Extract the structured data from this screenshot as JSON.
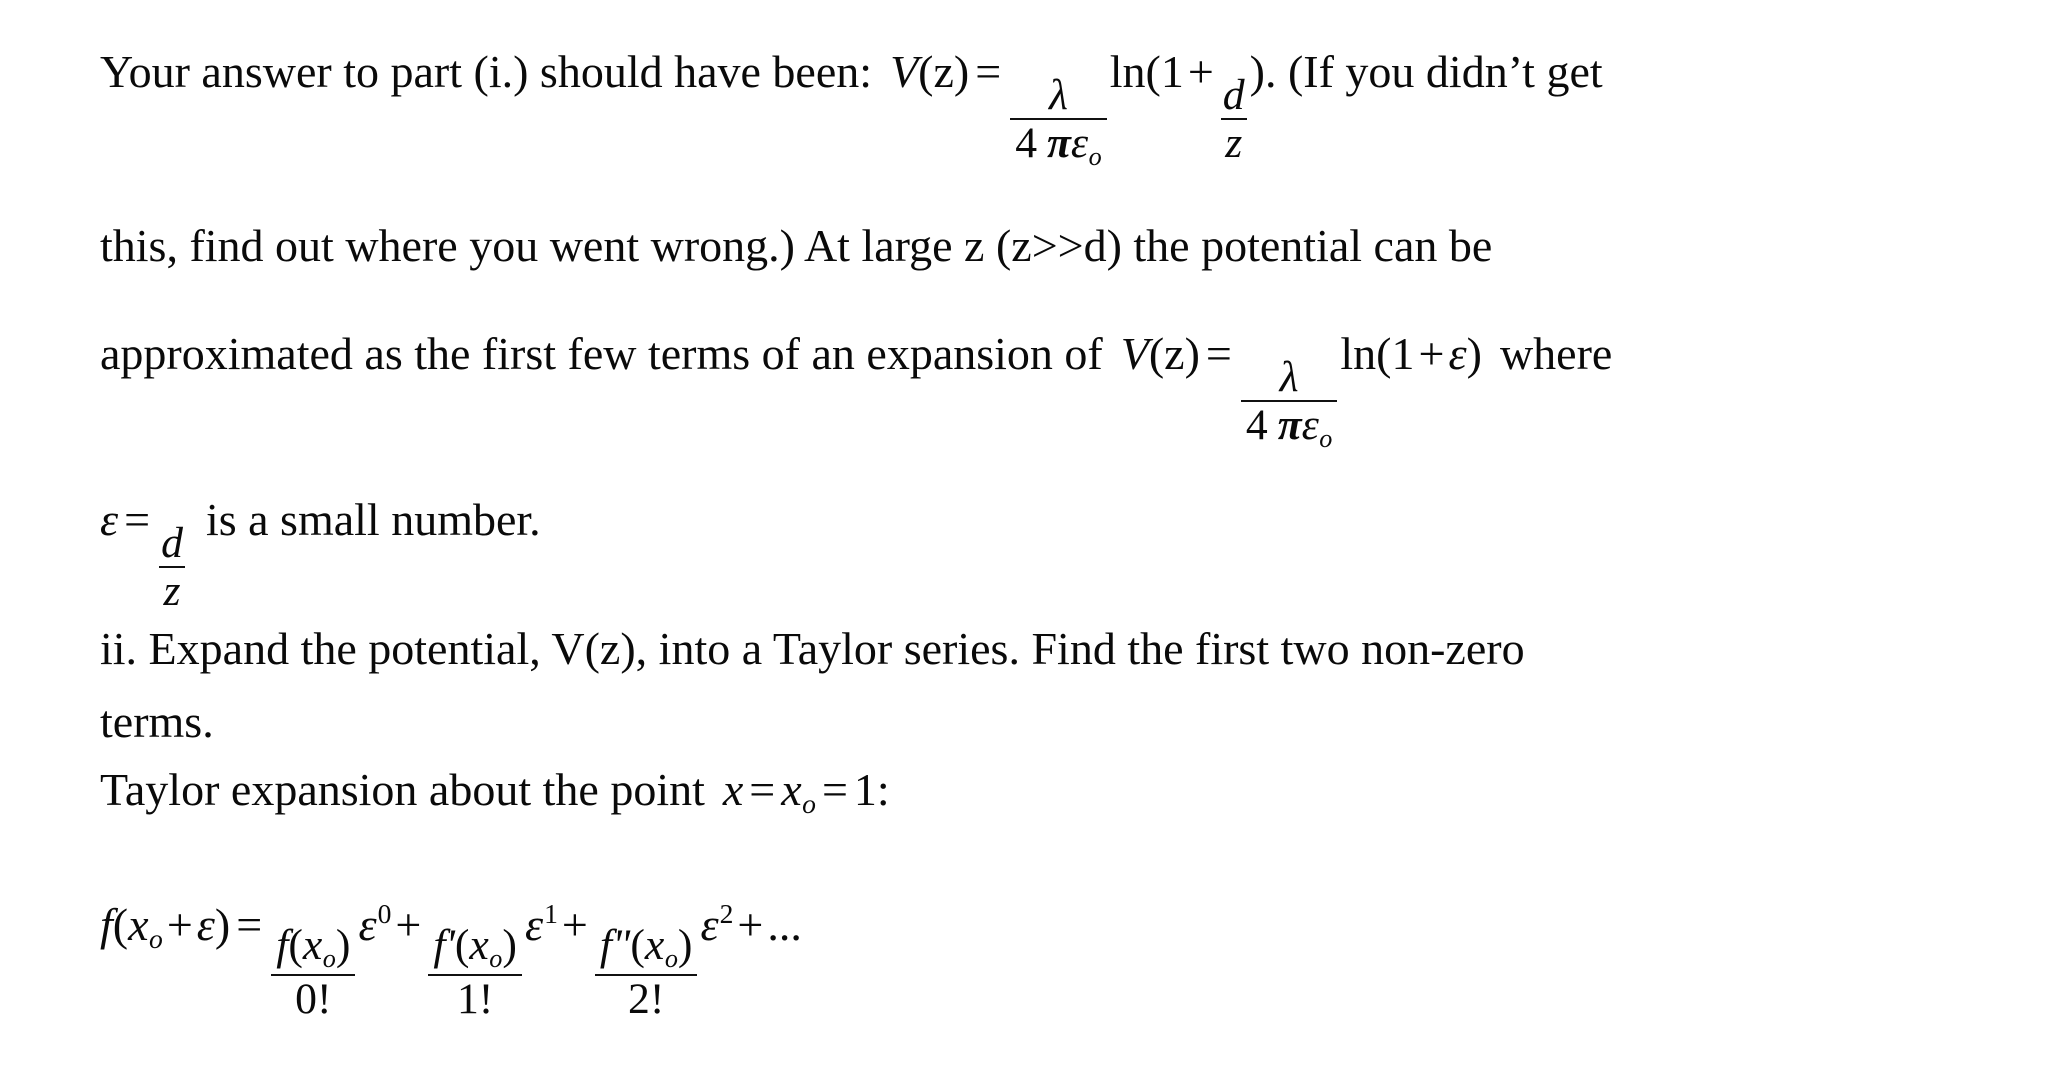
{
  "document": {
    "background_color": "#ffffff",
    "text_color": "#0a0a0a",
    "lines": {
      "line1": {
        "pre_formula": "Your answer to part (i.) should have been:",
        "post_formula": ". (If you didn’t get"
      },
      "line2": "this, find out where you went wrong.) At large z (z>>d) the potential can be",
      "line3": {
        "pre_formula": "approximated as the first few terms of  an expansion of",
        "post_formula": "where"
      },
      "line4": {
        "post_formula": "is a small number."
      },
      "line5": "ii. Expand the potential, V(z), into a Taylor series. Find the first two non-zero",
      "line6": "terms.",
      "line7": {
        "pre_formula": "Taylor expansion about the point"
      }
    }
  },
  "formulas": {
    "potential_d_over_z": {
      "lhs_fn": "V",
      "lhs_arg": "(z)",
      "equals": "=",
      "frac_numerator": "λ",
      "frac_denominator_4": "4",
      "frac_denominator_pi": "π",
      "frac_denominator_eps": "ε",
      "frac_denominator_sub": "o",
      "ln": "ln(1",
      "plus": "+",
      "inner_num": "d",
      "inner_den": "z",
      "close": ")"
    },
    "potential_epsilon": {
      "lhs_fn": "V",
      "lhs_arg": "(z)",
      "equals": "=",
      "frac_numerator": "λ",
      "frac_denominator_4": "4",
      "frac_denominator_pi": "π",
      "frac_denominator_eps": "ε",
      "frac_denominator_sub": "o",
      "ln": "ln(1",
      "plus": "+",
      "eps": "ε",
      "close": ")"
    },
    "epsilon_def": {
      "eps": "ε",
      "equals": "=",
      "num": "d",
      "den": "z"
    },
    "expansion_point": {
      "x": "x",
      "eq1": "=",
      "x_o": "x",
      "x_o_sub": "o",
      "eq2": "=",
      "value": "1",
      "colon": ":"
    },
    "taylor_series": {
      "lhs_f": "f",
      "lhs_open": "(",
      "lhs_x": "x",
      "lhs_x_sub": "o",
      "lhs_plus": "+",
      "lhs_eps": "ε",
      "lhs_close": ")",
      "equals": "=",
      "terms": [
        {
          "num_f": "f",
          "num_primes": "",
          "num_open": "(",
          "num_x": "x",
          "num_x_sub": "o",
          "num_close": ")",
          "den": "0!",
          "eps": "ε",
          "eps_power": "0",
          "trailing_op": "+"
        },
        {
          "num_f": "f",
          "num_primes": "'",
          "num_open": "(",
          "num_x": "x",
          "num_x_sub": "o",
          "num_close": ")",
          "den": "1!",
          "eps": "ε",
          "eps_power": "1",
          "trailing_op": "+"
        },
        {
          "num_f": "f",
          "num_primes": "\"",
          "num_open": "(",
          "num_x": "x",
          "num_x_sub": "o",
          "num_close": ")",
          "den": "2!",
          "eps": "ε",
          "eps_power": "2",
          "trailing_op": "+"
        }
      ],
      "ellipsis": "..."
    }
  }
}
